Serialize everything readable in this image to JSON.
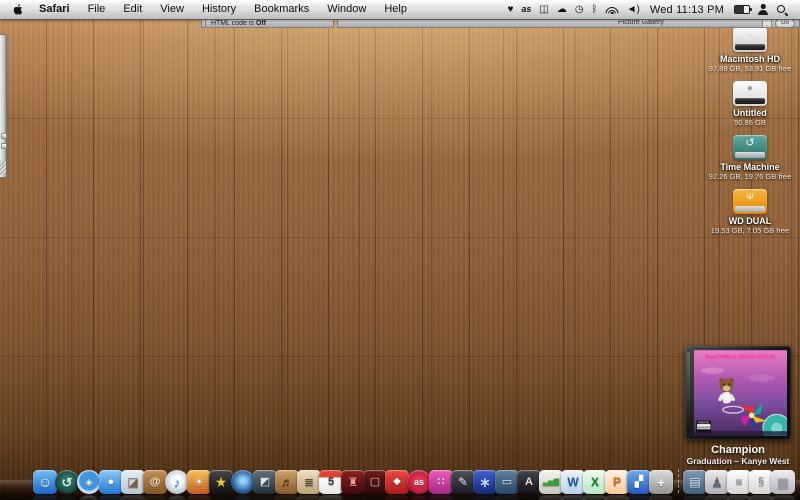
{
  "menu_bar": {
    "menus": [
      "Safari",
      "File",
      "Edit",
      "View",
      "History",
      "Bookmarks",
      "Window",
      "Help"
    ],
    "status": {
      "heart": "♥",
      "lastfm": "as",
      "book": "◫",
      "chat": "☁",
      "sync_clock": "◷",
      "bluetooth": "ᛒ",
      "volume": "◄)",
      "time": "Wed 11:13 PM"
    }
  },
  "window_strip": {
    "html_label": "HTML code is",
    "html_state": "Off",
    "gallery": "Picture Gallery",
    "stepper": "⌃⌄",
    "go": "Go"
  },
  "desktop": {
    "drives": [
      {
        "label": "Macintosh HD",
        "size": "97.88 GB, 53.91 GB free",
        "body": "linear-gradient(180deg,#fafafa,#c9c9c9)",
        "band": "linear-gradient(180deg,#3c3c3e,#1c1c1e)",
        "emblem": "∙",
        "emblem_color": "#8a8a8a",
        "emblem_size": "9px"
      },
      {
        "label": "Untitled",
        "size": "50.86 GB",
        "body": "linear-gradient(180deg,#fdfdfd,#d6d6d6)",
        "band": "linear-gradient(180deg,#38383a,#19191b)",
        "emblem": "◆",
        "emblem_color": "#9a9aa2",
        "emblem_size": "7px"
      },
      {
        "label": "Time Machine",
        "size": "92.26 GB, 19.76 GB free",
        "body": "linear-gradient(180deg,#5caaa1,#2d6f66)",
        "band": "linear-gradient(180deg,#d8dcde,#9aa2a8)",
        "emblem": "↺",
        "emblem_color": "#eefaf5",
        "emblem_size": "11px"
      },
      {
        "label": "WD DUAL",
        "size": "19.53 GB, 7.05 GB free",
        "body": "linear-gradient(180deg,#f9b441,#e28a02)",
        "band": "linear-gradient(180deg,#dcdcde,#a8a8ac)",
        "emblem": "Ψ",
        "emblem_color": "#ffffff",
        "emblem_size": "9px"
      }
    ]
  },
  "now_playing": {
    "title": "Champion",
    "subtitle": "Graduation – Kanye West",
    "art_title": "KanYeWest GRADUATION",
    "advisory_line1": "PARENTAL",
    "advisory_line2": "ADVISORY"
  },
  "dock": {
    "items": [
      {
        "name": "finder",
        "glyph": "☺",
        "bg": "linear-gradient(180deg,#72bdf2,#1f66c9)",
        "color": "#ffffff",
        "fs": 14
      },
      {
        "name": "time-machine",
        "glyph": "↺",
        "bg": "radial-gradient(circle at 50% 45%, #2e6f63 30%, #12302a 78%)",
        "color": "#cfeee2",
        "fw": 700,
        "round": true
      },
      {
        "name": "safari",
        "glyph": "◈",
        "bg": "radial-gradient(circle at 50% 45%, #3f97e0 52%, #c2d6e6 58%, #eef3f8 100%)",
        "color": "#ffffff",
        "fs": 9,
        "round": true
      },
      {
        "name": "ichat",
        "glyph": "●",
        "bg": "linear-gradient(180deg,#8ccaf5,#2277cf)",
        "color": "#ffffff",
        "fs": 11
      },
      {
        "name": "preview",
        "glyph": "◪",
        "bg": "linear-gradient(180deg,#e6eef5,#b7c4d1)",
        "color": "#7a5c3e",
        "fs": 12
      },
      {
        "name": "address-book",
        "glyph": "@",
        "bg": "linear-gradient(180deg,#c29158,#855627)",
        "color": "#f7edda",
        "fs": 11,
        "fw": 700
      },
      {
        "name": "itunes",
        "glyph": "♪",
        "bg": "radial-gradient(circle at 50% 45%, #fbfdff 25%, #c2cdd8 62%, #96a4b2 100%)",
        "color": "#2b7de0",
        "fw": 700,
        "round": true
      },
      {
        "name": "iphoto",
        "glyph": "☀",
        "bg": "linear-gradient(180deg,#f5c356,#c25a20)",
        "color": "#fff6df",
        "fs": 12
      },
      {
        "name": "star-app",
        "glyph": "★",
        "bg": "linear-gradient(180deg,#464646,#101010)",
        "color": "#e8c33c",
        "fs": 14
      },
      {
        "name": "dvd-player",
        "glyph": "○",
        "bg": "radial-gradient(circle at 50% 45%, #8fd0f8 15%, #2a5a9a 60%, #142f52 100%)",
        "color": "#d8eefc",
        "fs": 9,
        "round": true
      },
      {
        "name": "imovie",
        "glyph": "◩",
        "bg": "linear-gradient(180deg,#64747e,#222f38)",
        "color": "#dfe6ea",
        "fs": 11
      },
      {
        "name": "garageband",
        "glyph": "♬",
        "bg": "linear-gradient(180deg,#cfa468,#875a2c)",
        "color": "#3e270e",
        "fs": 12
      },
      {
        "name": "news-app",
        "glyph": "≣",
        "bg": "linear-gradient(180deg,#ecdfc6,#bca579)",
        "color": "#5a4a2e",
        "fs": 12
      },
      {
        "name": "ical",
        "glyph": "5",
        "bg": "linear-gradient(180deg,#e04438 0%,#e04438 32%,#fbfbfb 32%,#e6e6e6 100%)",
        "color": "#3a3a3a",
        "fs": 11,
        "fw": 700
      },
      {
        "name": "front-row",
        "glyph": "♜",
        "bg": "linear-gradient(180deg,#8e2020,#420b0b)",
        "color": "#eda0a0",
        "fs": 12
      },
      {
        "name": "theater-app",
        "glyph": "▢",
        "bg": "linear-gradient(180deg,#6e1d1d,#2c0909)",
        "color": "#e4c4c4",
        "fs": 11
      },
      {
        "name": "red-app",
        "glyph": "◆",
        "bg": "linear-gradient(180deg,#ea4940,#ad1a1a)",
        "color": "#ffffff",
        "fs": 10
      },
      {
        "name": "lastfm",
        "glyph": "as",
        "bg": "radial-gradient(circle at 50% 45%, #ee4464, #b01333 78%)",
        "color": "#ffffff",
        "fs": 9,
        "fw": 700,
        "round": true
      },
      {
        "name": "magenta-app",
        "glyph": "∷",
        "bg": "linear-gradient(180deg,#ec5cbc,#a52687)",
        "color": "#fff0fa",
        "fs": 11,
        "fw": 700
      },
      {
        "name": "pen-app",
        "glyph": "✎",
        "bg": "linear-gradient(180deg,#50505a,#1a1a20)",
        "color": "#e9e9f2",
        "fs": 12
      },
      {
        "name": "wizard-app",
        "glyph": "∗",
        "bg": "linear-gradient(180deg,#3e61ce,#182a78)",
        "color": "#bcd0ff",
        "fs": 14,
        "fw": 700
      },
      {
        "name": "keynote",
        "glyph": "▭",
        "bg": "linear-gradient(180deg,#60809f,#294868)",
        "color": "#f2f6fa",
        "fs": 11
      },
      {
        "name": "pages",
        "glyph": "A",
        "bg": "linear-gradient(180deg,#44444c,#131317)",
        "color": "#ece2cc",
        "fs": 11,
        "fw": 700
      },
      {
        "name": "numbers",
        "glyph": "▃▅▇",
        "bg": "linear-gradient(180deg,#f6f6f2,#c6c6bc)",
        "color": "#3a9a3a",
        "fs": 7
      },
      {
        "name": "word",
        "glyph": "W",
        "bg": "linear-gradient(180deg,#eef4fb,#b9d2ea)",
        "color": "#1f5aa8",
        "fs": 12,
        "fw": 700
      },
      {
        "name": "excel",
        "glyph": "X",
        "bg": "linear-gradient(180deg,#ecfaef,#b9e8c6)",
        "color": "#1e7a2e",
        "fs": 12,
        "fw": 700
      },
      {
        "name": "powerpoint",
        "glyph": "P",
        "bg": "linear-gradient(180deg,#fdf1e5,#f6cb9a)",
        "color": "#d2641e",
        "fs": 12,
        "fw": 700
      },
      {
        "name": "messenger",
        "glyph": "▞",
        "bg": "linear-gradient(180deg,#6fabe9,#2856c4)",
        "color": "#ffffff",
        "fs": 11
      },
      {
        "name": "spaces-app",
        "glyph": "+",
        "bg": "linear-gradient(180deg,#dcdcdc,#939393)",
        "color": "#ffffff",
        "fs": 13,
        "fw": 700
      },
      {
        "sep": true
      },
      {
        "name": "downloads-stack",
        "glyph": "▤",
        "bg": "linear-gradient(180deg,#7f98b2,#43607c)",
        "color": "#dde7f0",
        "fs": 12
      },
      {
        "name": "documents-stack",
        "glyph": "♟",
        "bg": "linear-gradient(180deg,#ececec,#aeaeb6)",
        "color": "#68686f",
        "fs": 13
      },
      {
        "name": "document-stack",
        "glyph": "≡",
        "bg": "linear-gradient(180deg,#fdfdfd,#d6d6d6)",
        "color": "#8a8a8a",
        "fs": 12
      },
      {
        "name": "certificate-stack",
        "glyph": "§",
        "bg": "linear-gradient(180deg,#fdfdfd,#d6d6d6)",
        "color": "#8a8a8a",
        "fs": 11
      },
      {
        "name": "trash",
        "glyph": "▦",
        "bg": "linear-gradient(180deg,#eeeef2,#b4b4bc)",
        "color": "#97979f",
        "fs": 13
      }
    ]
  }
}
